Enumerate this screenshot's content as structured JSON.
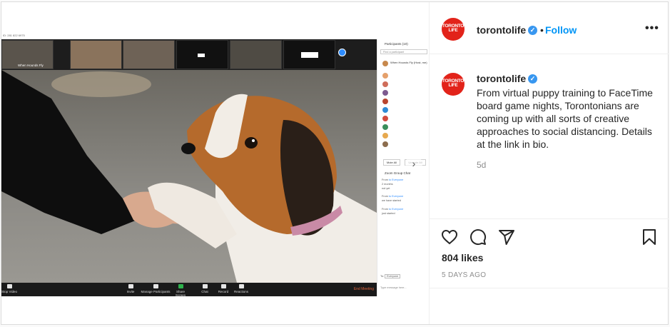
{
  "post": {
    "username": "torontolife",
    "verified_mark": "✓",
    "follow_label": "Follow",
    "separator": "•",
    "more_label": "•••",
    "logo_text_line1": "TORONTO",
    "logo_text_line2": "LIFE",
    "caption": "From virtual puppy training to FaceTime board game nights, Torontonians are coming up with all sorts of creative approaches to social distancing. Details at the link in bio.",
    "age": "5d",
    "likes": "804 likes",
    "timestamp": "5 DAYS AGO",
    "icons": [
      "heart-icon",
      "comment-icon",
      "share-icon",
      "bookmark-icon",
      "verified-icon",
      "more-options-icon",
      "chevron-right-icon"
    ],
    "colors": {
      "brand_red": "#e2231a",
      "link_blue": "#0095f6",
      "verified_blue": "#3897f0"
    }
  },
  "media": {
    "call_window_title": "ID: 281 822 6975",
    "thumb_caption": "When Hounds Fly",
    "participants_header": "Participants (10)",
    "find_placeholder": "Find a participant",
    "participant_first": "When Hounds Fly (Host, me)",
    "mute_all": "Mute All",
    "unmute_all": "Unmute All",
    "chat_header": "Zoom Group Chat",
    "chat_lines": [
      {
        "from": "From",
        "to": "to Everyone",
        "msg": "2 months"
      },
      {
        "from": "",
        "to": "",
        "msg": "not yet"
      },
      {
        "from": "From",
        "to": "to Everyone",
        "msg": "we have started"
      },
      {
        "from": "From",
        "to": "to Everyone",
        "msg": "just started"
      }
    ],
    "to_label": "To:",
    "to_value": "Everyone",
    "message_placeholder": "Type message here...",
    "toolbar": [
      "Stop Video",
      "Invite",
      "Manage Participants",
      "Share Screen",
      "Chat",
      "Record",
      "Reactions"
    ],
    "participant_count": "10",
    "end_meeting": "End Meeting"
  }
}
